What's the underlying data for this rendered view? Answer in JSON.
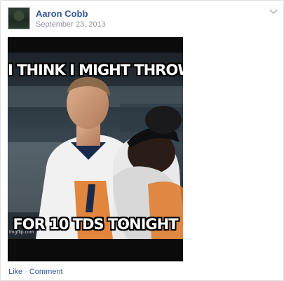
{
  "post": {
    "author": "Aaron Cobb",
    "timestamp": "September 23, 2013",
    "menu_icon": "chevron-down-icon",
    "photo": {
      "top_text": "I THINK I MIGHT THROW",
      "bottom_text": "FOR 10 TDS TONIGHT",
      "watermark": "imgflip.com"
    },
    "actions": {
      "like": "Like",
      "separator": "·",
      "comment": "Comment"
    }
  },
  "colors": {
    "link": "#365899",
    "meta": "#90949c",
    "border": "#dddfe2"
  }
}
